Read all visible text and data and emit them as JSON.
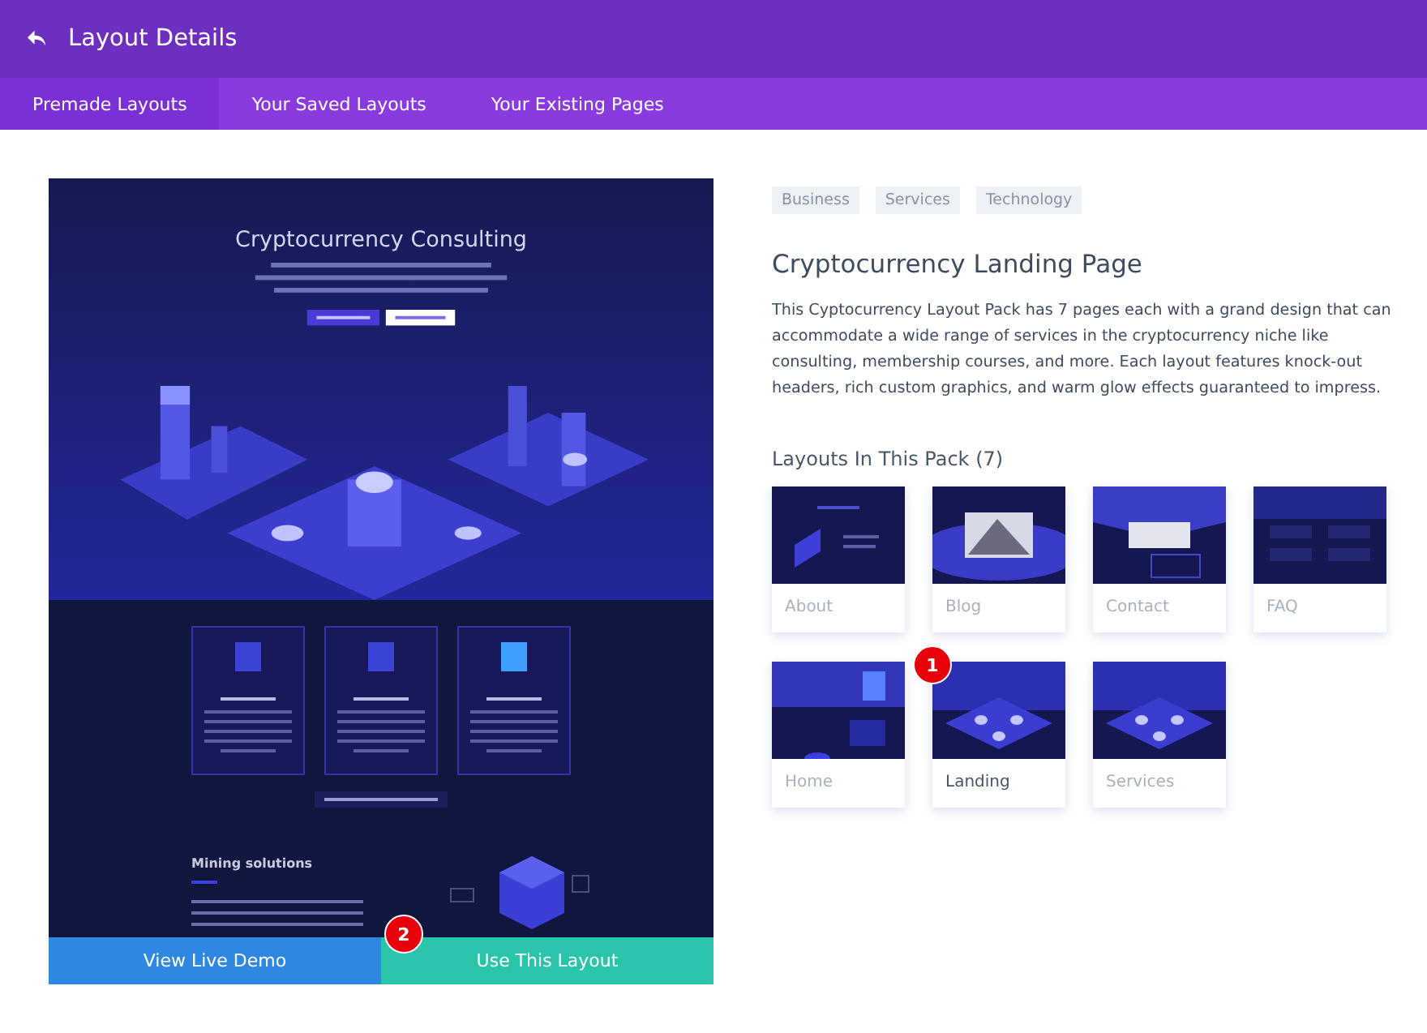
{
  "header": {
    "title": "Layout Details"
  },
  "tabs": [
    {
      "label": "Premade Layouts",
      "selected": true
    },
    {
      "label": "Your Saved Layouts",
      "selected": false
    },
    {
      "label": "Your Existing Pages",
      "selected": false
    }
  ],
  "preview": {
    "hero_title": "Cryptocurrency Consulting",
    "section_title": "Mining solutions"
  },
  "actions": [
    {
      "kind": "demo",
      "label": "View Live Demo"
    },
    {
      "kind": "use",
      "label": "Use This Layout",
      "marker": "2"
    }
  ],
  "tags": [
    "Business",
    "Services",
    "Technology"
  ],
  "title": "Cryptocurrency Landing Page",
  "description": "This Cyptocurrency Layout Pack has 7 pages each with a grand design that can accommodate a wide range of services in the cryptocurrency niche like consulting, membership courses, and more. Each layout features knock-out headers, rich custom graphics, and warm glow effects guaranteed to impress.",
  "pack_heading": "Layouts In This Pack (7)",
  "layouts": [
    {
      "label": "About",
      "selected": false
    },
    {
      "label": "Blog",
      "selected": false
    },
    {
      "label": "Contact",
      "selected": false
    },
    {
      "label": "FAQ",
      "selected": false
    },
    {
      "label": "Home",
      "selected": false
    },
    {
      "label": "Landing",
      "selected": true,
      "marker": "1"
    },
    {
      "label": "Services",
      "selected": false
    }
  ]
}
